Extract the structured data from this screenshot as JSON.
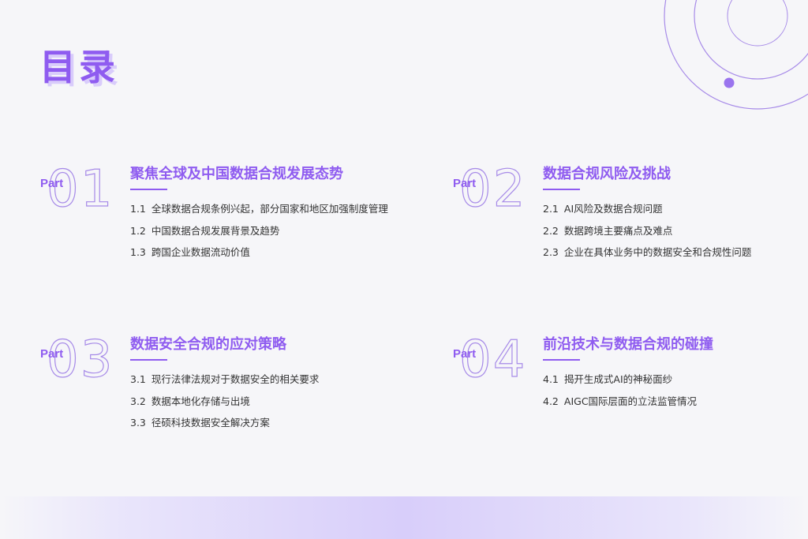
{
  "title": "目录",
  "accent_color": "#8f5cf0",
  "parts": [
    {
      "tag": "Part",
      "number": "01",
      "heading": "聚焦全球及中国数据合规发展态势",
      "items": [
        {
          "no": "1.1",
          "text": "全球数据合规条例兴起，部分国家和地区加强制度管理"
        },
        {
          "no": "1.2",
          "text": "中国数据合规发展背景及趋势"
        },
        {
          "no": "1.3",
          "text": "跨国企业数据流动价值"
        }
      ]
    },
    {
      "tag": "Part",
      "number": "02",
      "heading": "数据合规风险及挑战",
      "items": [
        {
          "no": "2.1",
          "text": "AI风险及数据合规问题"
        },
        {
          "no": "2.2",
          "text": "数据跨境主要痛点及难点"
        },
        {
          "no": "2.3",
          "text": "企业在具体业务中的数据安全和合规性问题"
        }
      ]
    },
    {
      "tag": "Part",
      "number": "03",
      "heading": "数据安全合规的应对策略",
      "items": [
        {
          "no": "3.1",
          "text": "现行法律法规对于数据安全的相关要求"
        },
        {
          "no": "3.2",
          "text": "数据本地化存储与出境"
        },
        {
          "no": "3.3",
          "text": "径硕科技数据安全解决方案"
        }
      ]
    },
    {
      "tag": "Part",
      "number": "04",
      "heading": "前沿技术与数据合规的碰撞",
      "items": [
        {
          "no": "4.1",
          "text": "揭开生成式AI的神秘面纱"
        },
        {
          "no": "4.2",
          "text": "AIGC国际层面的立法监管情况"
        }
      ]
    }
  ]
}
